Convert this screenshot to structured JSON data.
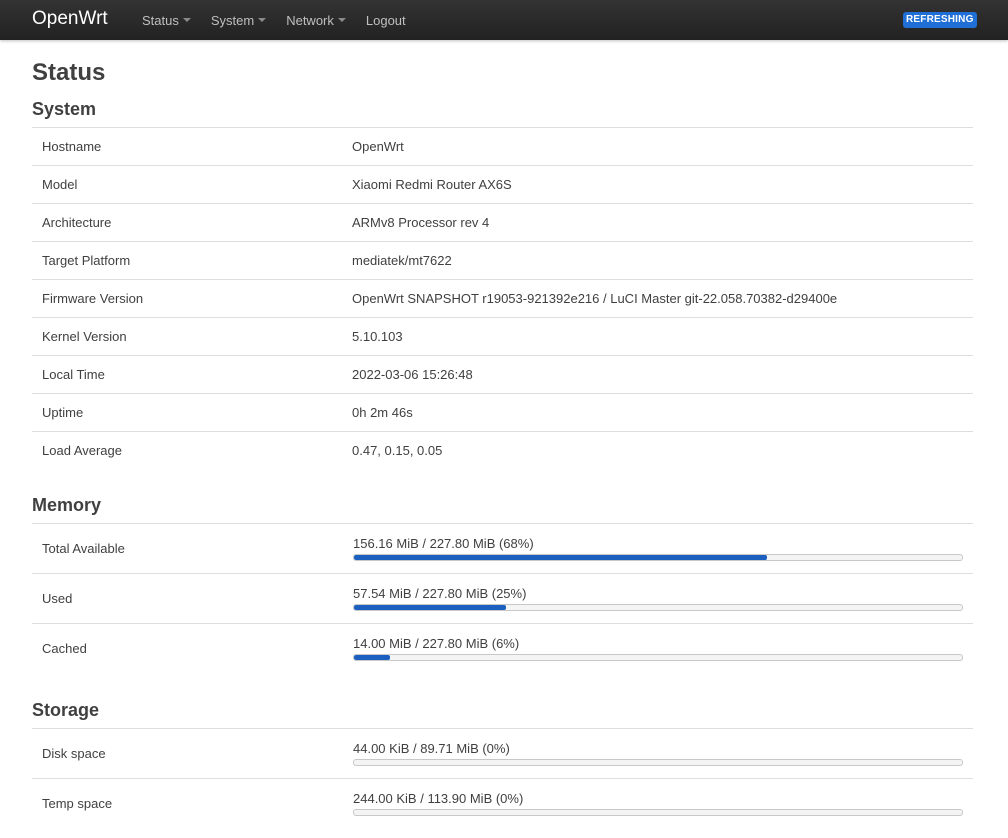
{
  "brand": "OpenWrt",
  "menu": [
    {
      "label": "Status",
      "has_caret": true
    },
    {
      "label": "System",
      "has_caret": true
    },
    {
      "label": "Network",
      "has_caret": true
    },
    {
      "label": "Logout",
      "has_caret": false
    }
  ],
  "indicator": "REFRESHING",
  "page_title": "Status",
  "system": {
    "title": "System",
    "rows": [
      {
        "label": "Hostname",
        "value": "OpenWrt"
      },
      {
        "label": "Model",
        "value": "Xiaomi Redmi Router AX6S"
      },
      {
        "label": "Architecture",
        "value": "ARMv8 Processor rev 4"
      },
      {
        "label": "Target Platform",
        "value": "mediatek/mt7622"
      },
      {
        "label": "Firmware Version",
        "value": "OpenWrt SNAPSHOT r19053-921392e216 / LuCI Master git-22.058.70382-d29400e"
      },
      {
        "label": "Kernel Version",
        "value": "5.10.103"
      },
      {
        "label": "Local Time",
        "value": "2022-03-06 15:26:48"
      },
      {
        "label": "Uptime",
        "value": "0h 2m 46s"
      },
      {
        "label": "Load Average",
        "value": "0.47, 0.15, 0.05"
      }
    ]
  },
  "memory": {
    "title": "Memory",
    "rows": [
      {
        "label": "Total Available",
        "text": "156.16 MiB / 227.80 MiB (68%)",
        "percent": 68
      },
      {
        "label": "Used",
        "text": "57.54 MiB / 227.80 MiB (25%)",
        "percent": 25
      },
      {
        "label": "Cached",
        "text": "14.00 MiB / 227.80 MiB (6%)",
        "percent": 6
      }
    ]
  },
  "storage": {
    "title": "Storage",
    "rows": [
      {
        "label": "Disk space",
        "text": "44.00 KiB / 89.71 MiB (0%)",
        "percent": 0
      },
      {
        "label": "Temp space",
        "text": "244.00 KiB / 113.90 MiB (0%)",
        "percent": 0
      }
    ]
  },
  "colors": {
    "bar_fill": "#1b5fbf",
    "indicator_bg": "#1f6fd6",
    "topbar": "#222222"
  }
}
